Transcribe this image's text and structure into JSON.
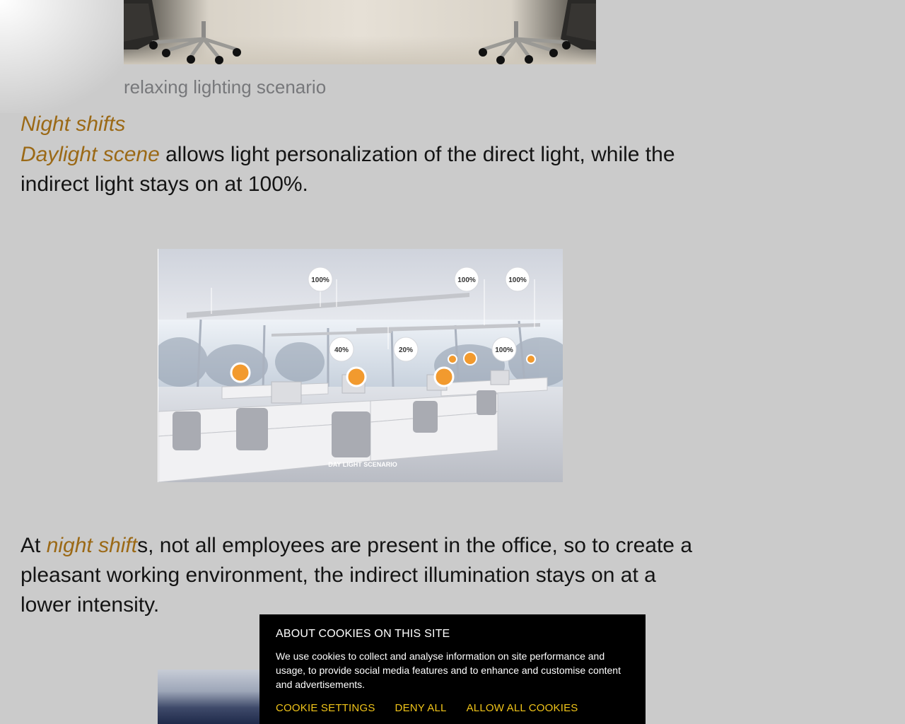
{
  "top_image": {
    "caption": "relaxing lighting scenario"
  },
  "night_section": {
    "title": "Night shifts",
    "para1_highlight": "Daylight scene",
    "para1_rest": " allows light personalization of the direct light, while the indirect light stays on at 100%.",
    "para2_prefix": "At ",
    "para2_highlight": "night shift",
    "para2_rest": "s, not all employees are present in the office, so to create a pleasant working environment, the indirect illumination stays on at a lower intensity."
  },
  "daylight_image": {
    "labels": {
      "ceiling_1": "100%",
      "ceiling_2": "100%",
      "ceiling_3": "100%",
      "desk_1": "40%",
      "desk_2": "20%",
      "desk_3": "100%"
    },
    "footer": "DAY LIGHT SCENARIO"
  },
  "cookie_banner": {
    "title": "ABOUT COOKIES ON THIS SITE",
    "text": "We use cookies to collect and analyse information on site performance and usage, to provide social media features and to enhance and customise content and advertisements.",
    "buttons": {
      "settings": "COOKIE SETTINGS",
      "deny": "DENY ALL",
      "allow": "ALLOW ALL COOKIES"
    }
  },
  "colors": {
    "background": "#cbcbcb",
    "accent": "#9b6916",
    "cookie_bg": "#000000",
    "cookie_link": "#f0c419",
    "caption": "#77787b"
  }
}
